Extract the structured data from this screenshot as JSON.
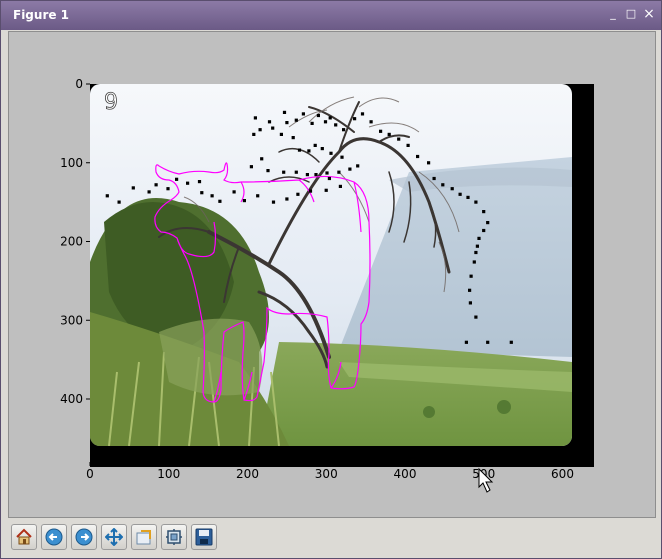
{
  "window": {
    "title": "Figure 1",
    "controls": {
      "minimize": "_",
      "maximize": "□",
      "close": "×"
    }
  },
  "figure": {
    "panel_label": "9",
    "background": "#bfbfbf",
    "overlay_color": "#ff00ff",
    "marker_color": "#000000"
  },
  "chart_data": {
    "type": "scatter",
    "xlim": [
      0,
      640
    ],
    "ylim": [
      480,
      0
    ],
    "xticks": [
      0,
      100,
      200,
      300,
      400,
      500,
      600
    ],
    "yticks": [
      0,
      100,
      200,
      300,
      400
    ],
    "grid": false,
    "series": [
      {
        "marker": "square",
        "color": "#000000",
        "points": [
          [
            22,
            142
          ],
          [
            37,
            150
          ],
          [
            55,
            132
          ],
          [
            75,
            137
          ],
          [
            84,
            128
          ],
          [
            99,
            133
          ],
          [
            110,
            121
          ],
          [
            124,
            126
          ],
          [
            139,
            124
          ],
          [
            142,
            138
          ],
          [
            155,
            142
          ],
          [
            165,
            149
          ],
          [
            183,
            137
          ],
          [
            196,
            148
          ],
          [
            213,
            142
          ],
          [
            233,
            150
          ],
          [
            250,
            146
          ],
          [
            264,
            140
          ],
          [
            280,
            136
          ],
          [
            300,
            135
          ],
          [
            318,
            130
          ],
          [
            205,
            105
          ],
          [
            218,
            95
          ],
          [
            226,
            110
          ],
          [
            246,
            112
          ],
          [
            262,
            112
          ],
          [
            276,
            115
          ],
          [
            287,
            115
          ],
          [
            301,
            113
          ],
          [
            304,
            120
          ],
          [
            316,
            112
          ],
          [
            330,
            108
          ],
          [
            340,
            104
          ],
          [
            320,
            93
          ],
          [
            306,
            88
          ],
          [
            295,
            82
          ],
          [
            286,
            78
          ],
          [
            278,
            85
          ],
          [
            266,
            84
          ],
          [
            258,
            68
          ],
          [
            243,
            64
          ],
          [
            250,
            49
          ],
          [
            228,
            48
          ],
          [
            216,
            58
          ],
          [
            208,
            64
          ],
          [
            210,
            43
          ],
          [
            232,
            56
          ],
          [
            247,
            36
          ],
          [
            262,
            46
          ],
          [
            271,
            38
          ],
          [
            282,
            50
          ],
          [
            290,
            40
          ],
          [
            299,
            48
          ],
          [
            305,
            43
          ],
          [
            312,
            52
          ],
          [
            322,
            58
          ],
          [
            336,
            44
          ],
          [
            346,
            38
          ],
          [
            357,
            48
          ],
          [
            369,
            60
          ],
          [
            380,
            64
          ],
          [
            392,
            70
          ],
          [
            404,
            78
          ],
          [
            416,
            92
          ],
          [
            430,
            100
          ],
          [
            437,
            120
          ],
          [
            448,
            128
          ],
          [
            460,
            133
          ],
          [
            470,
            140
          ],
          [
            480,
            144
          ],
          [
            490,
            150
          ],
          [
            500,
            162
          ],
          [
            505,
            176
          ],
          [
            500,
            186
          ],
          [
            494,
            196
          ],
          [
            492,
            206
          ],
          [
            490,
            214
          ],
          [
            488,
            226
          ],
          [
            484,
            244
          ],
          [
            482,
            262
          ],
          [
            483,
            278
          ],
          [
            490,
            296
          ],
          [
            478,
            328
          ],
          [
            505,
            328
          ],
          [
            535,
            328
          ]
        ]
      }
    ]
  }
}
